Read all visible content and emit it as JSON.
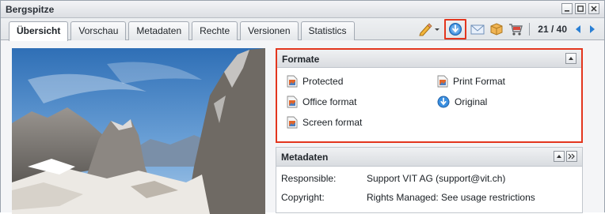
{
  "window": {
    "title": "Bergspitze"
  },
  "window_buttons": [
    "minimize",
    "maximize",
    "close"
  ],
  "tabs": [
    {
      "label": "Übersicht",
      "active": true
    },
    {
      "label": "Vorschau",
      "active": false
    },
    {
      "label": "Metadaten",
      "active": false
    },
    {
      "label": "Rechte",
      "active": false
    },
    {
      "label": "Versionen",
      "active": false
    },
    {
      "label": "Statistics",
      "active": false
    }
  ],
  "toolbar": {
    "icons": [
      "pencil-icon",
      "download-icon",
      "mail-icon",
      "package-icon",
      "cart-icon",
      "prev-arrow-icon",
      "next-arrow-icon"
    ],
    "pager": "21 / 40"
  },
  "formate": {
    "title": "Formate",
    "items": [
      {
        "label": "Protected",
        "icon": "image-file-icon"
      },
      {
        "label": "Print Format",
        "icon": "image-file-icon"
      },
      {
        "label": "Office format",
        "icon": "image-file-icon"
      },
      {
        "label": "Original",
        "icon": "download-icon"
      },
      {
        "label": "Screen format",
        "icon": "image-file-icon"
      }
    ]
  },
  "metadaten": {
    "title": "Metadaten",
    "rows": [
      {
        "label": "Responsible:",
        "value": "Support VIT AG (support@vit.ch)"
      },
      {
        "label": "Copyright:",
        "value": "Rights Managed: See usage restrictions"
      }
    ]
  },
  "colors": {
    "highlight": "#e3361e",
    "accent_blue": "#2a7fd4"
  }
}
